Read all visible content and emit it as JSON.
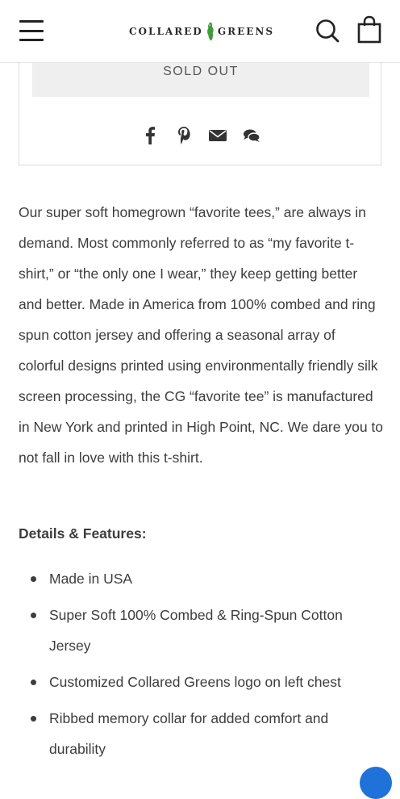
{
  "header": {
    "logo_left": "COLLARED",
    "logo_right": "GREENS"
  },
  "product": {
    "sold_out_label": "SOLD OUT"
  },
  "description": "Our super soft homegrown “favorite tees,” are always in demand. Most commonly referred to as “my favorite t-shirt,” or “the only one I wear,” they keep getting better and better. Made in America from 100% combed and ring spun cotton jersey and offering a seasonal array of colorful designs printed using environmentally friendly silk screen processing, the CG “favorite tee” is manufactured in New York and printed in High Point, NC. We dare you to not fall in love with this t-shirt.",
  "details": {
    "title": "Details & Features:",
    "items": [
      "Made in USA",
      "Super Soft 100% Combed & Ring-Spun Cotton Jersey",
      "Customized Collared Greens logo on left chest",
      "Ribbed memory collar for added comfort and durability"
    ]
  },
  "icons": {
    "menu": "hamburger-menu-icon",
    "search": "search-icon",
    "cart": "shopping-bag-icon",
    "share": [
      "facebook-icon",
      "pinterest-icon",
      "email-icon",
      "comments-icon"
    ],
    "chat": "chat-icon"
  },
  "colors": {
    "accent": "#1e72d9",
    "logo_green": "#3f9b3a",
    "text": "#3d3d3d",
    "button_bg": "#efefef"
  }
}
